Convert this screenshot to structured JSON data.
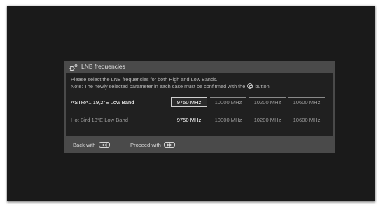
{
  "dialog": {
    "title": "LNB frequencies",
    "icon": "gear-icon",
    "instructions": {
      "line1": "Please select the LNB frequencies for both High and Low Bands.",
      "line2_prefix": "Note: The newly selected parameter in each case must be confirmed with the",
      "line2_suffix": "button.",
      "ok_icon": "ok-button-icon"
    },
    "bands": [
      {
        "label": "ASTRA1 19,2°E Low Band",
        "state": "active",
        "options": [
          "9750 MHz",
          "10000 MHz",
          "10200 MHz",
          "10600 MHz"
        ],
        "selected_index": 0
      },
      {
        "label": "Hot Bird 13°E Low Band",
        "state": "inactive",
        "options": [
          "9750 MHz",
          "10000 MHz",
          "10200 MHz",
          "10600 MHz"
        ],
        "selected_index": 0
      }
    ],
    "footer": {
      "back_label": "Back with",
      "back_icon": "rewind-key-icon",
      "proceed_label": "Proceed with",
      "proceed_icon": "fast-forward-key-icon"
    }
  },
  "colors": {
    "screen_bg": "#1a1a1a",
    "dialog_frame": "#4a4a4a",
    "dialog_body": "#202020",
    "text_primary": "#ffffff",
    "text_secondary": "#9a9a9a"
  }
}
